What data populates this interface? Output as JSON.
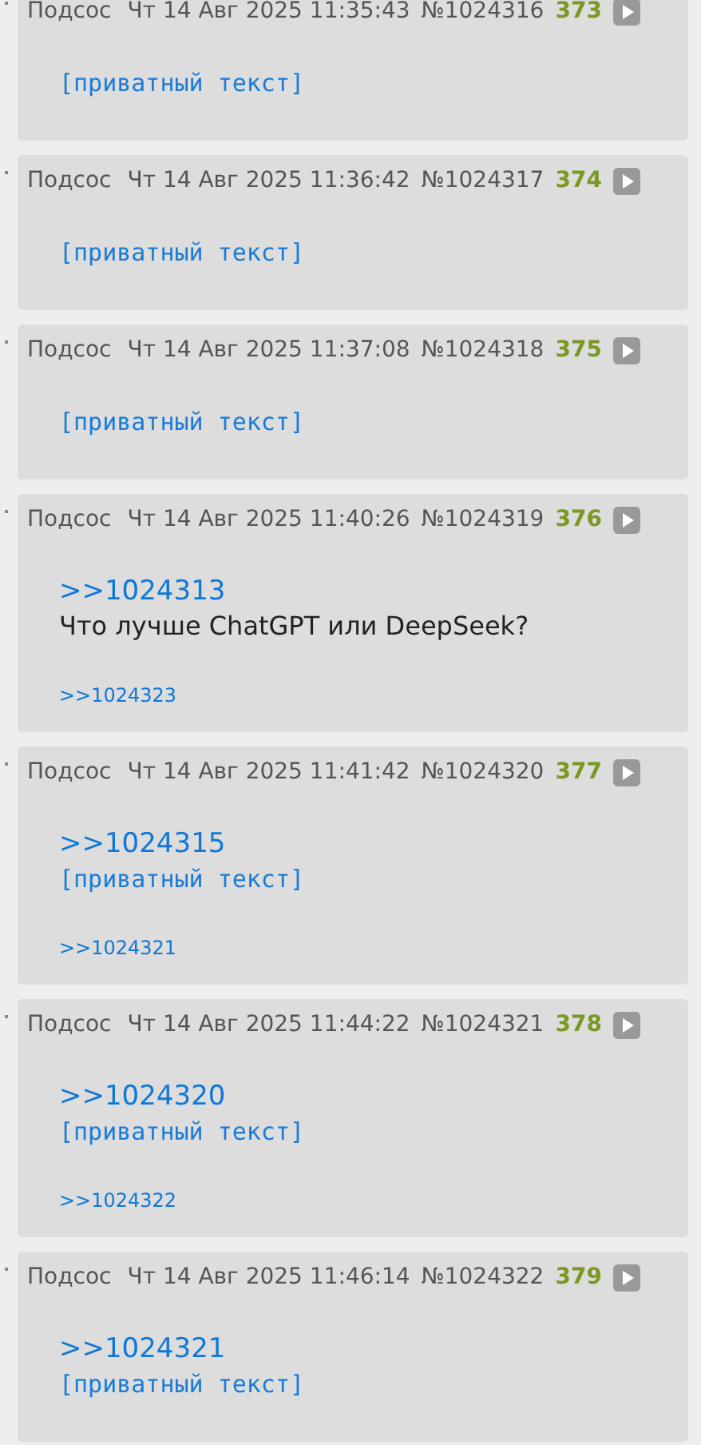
{
  "posts": [
    {
      "author": "Подсос",
      "date": "Чт 14 Авг 2025 11:35:43",
      "number": "№1024316",
      "index": "373",
      "body": [
        {
          "kind": "private",
          "text": "[приватный текст]"
        }
      ]
    },
    {
      "author": "Подсос",
      "date": "Чт 14 Авг 2025 11:36:42",
      "number": "№1024317",
      "index": "374",
      "body": [
        {
          "kind": "private",
          "text": "[приватный текст]"
        }
      ]
    },
    {
      "author": "Подсос",
      "date": "Чт 14 Авг 2025 11:37:08",
      "number": "№1024318",
      "index": "375",
      "body": [
        {
          "kind": "private",
          "text": "[приватный текст]"
        }
      ]
    },
    {
      "author": "Подсос",
      "date": "Чт 14 Авг 2025 11:40:26",
      "number": "№1024319",
      "index": "376",
      "body": [
        {
          "kind": "reply_link",
          "text": ">>1024313"
        },
        {
          "kind": "text",
          "text": "Что лучше ChatGPT или DeepSeek?"
        }
      ],
      "replies": [
        ">>1024323"
      ]
    },
    {
      "author": "Подсос",
      "date": "Чт 14 Авг 2025 11:41:42",
      "number": "№1024320",
      "index": "377",
      "body": [
        {
          "kind": "reply_link",
          "text": ">>1024315"
        },
        {
          "kind": "private",
          "text": "[приватный текст]"
        }
      ],
      "replies": [
        ">>1024321"
      ]
    },
    {
      "author": "Подсос",
      "date": "Чт 14 Авг 2025 11:44:22",
      "number": "№1024321",
      "index": "378",
      "body": [
        {
          "kind": "reply_link",
          "text": ">>1024320"
        },
        {
          "kind": "private",
          "text": "[приватный текст]"
        }
      ],
      "replies": [
        ">>1024322"
      ]
    },
    {
      "author": "Подсос",
      "date": "Чт 14 Авг 2025 11:46:14",
      "number": "№1024322",
      "index": "379",
      "body": [
        {
          "kind": "reply_link",
          "text": ">>1024321"
        },
        {
          "kind": "private",
          "text": "[приватный текст]"
        }
      ]
    }
  ]
}
